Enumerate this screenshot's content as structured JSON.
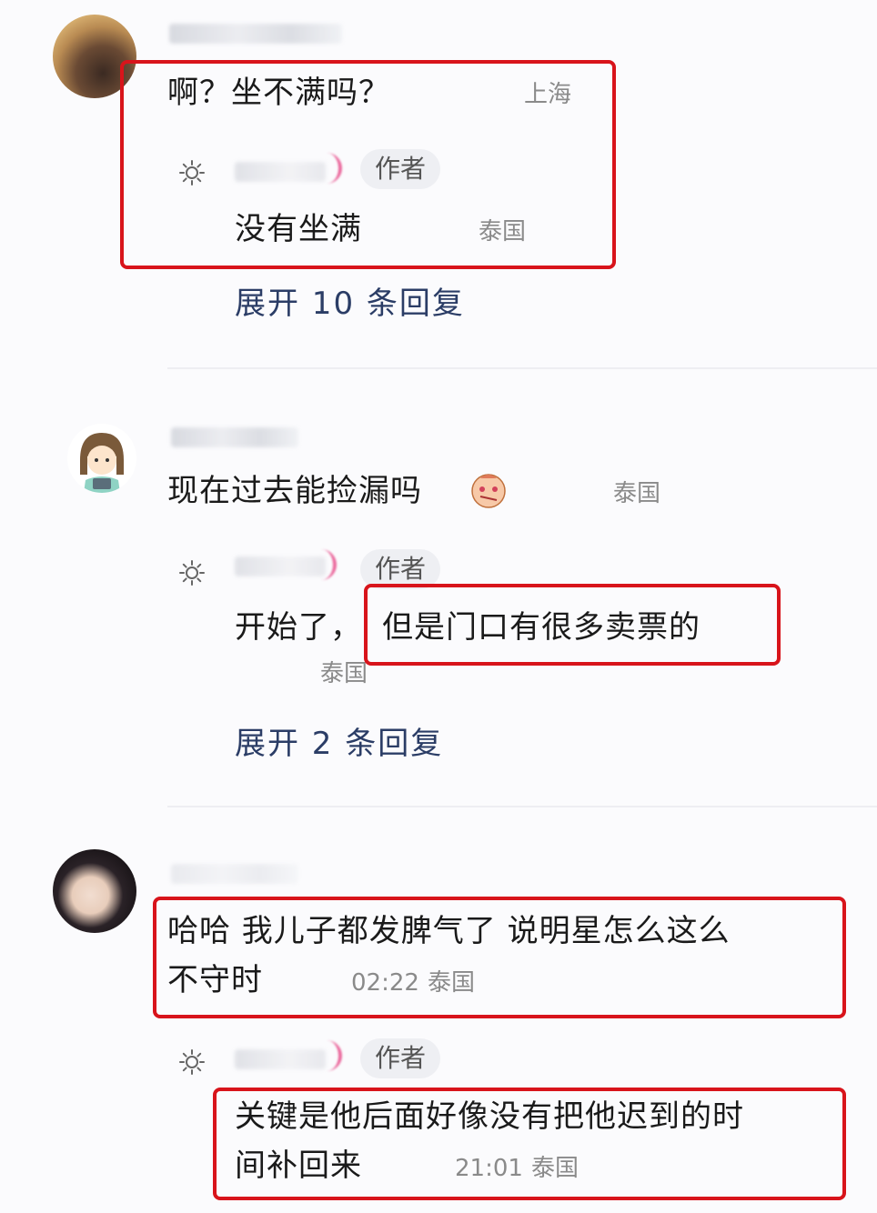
{
  "comments": [
    {
      "text": "啊？坐不满吗？",
      "location": "上海",
      "reply": {
        "badge": "作者",
        "text": "没有坐满",
        "location": "泰国"
      },
      "expand": "展开 10 条回复"
    },
    {
      "text": "现在过去能捡漏吗",
      "location": "泰国",
      "reply": {
        "badge": "作者",
        "text_prefix": "开始了，",
        "text_highlight": "但是门口有很多卖票的",
        "location": "泰国"
      },
      "expand": "展开 2 条回复"
    },
    {
      "text_line1": "哈哈 我儿子都发脾气了 说明星怎么这么",
      "text_line2": "不守时",
      "time": "02:22",
      "location": "泰国",
      "reply": {
        "badge": "作者",
        "text_line1": "关键是他后面好像没有把他迟到的时",
        "text_line2": "间补回来",
        "time": "21:01",
        "location": "泰国"
      }
    }
  ],
  "icons": {
    "sun": "sun-icon",
    "emoji": "face-emoji-icon"
  },
  "colors": {
    "highlight_border": "#d8141b",
    "expand_link": "#2b3d66",
    "meta": "#8a8a8a"
  }
}
